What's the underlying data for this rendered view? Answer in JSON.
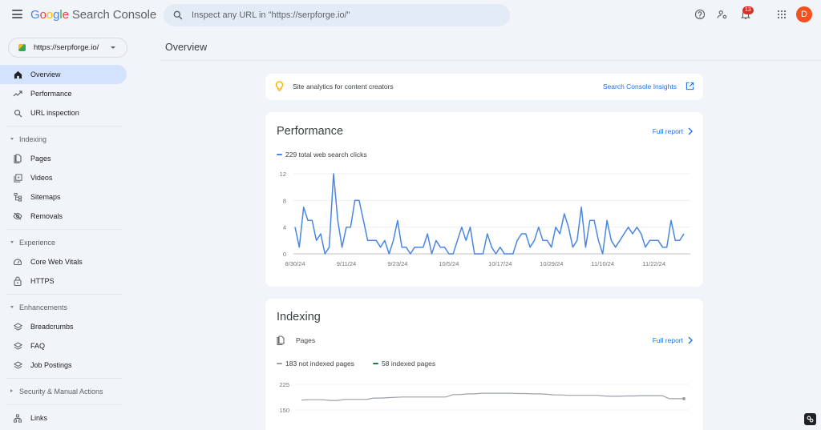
{
  "header": {
    "logo_letters": [
      "G",
      "o",
      "o",
      "g",
      "l",
      "e"
    ],
    "product": "Search Console",
    "search_placeholder": "Inspect any URL in \"https://serpforge.io/\"",
    "notification_count": "13",
    "avatar_initial": "D",
    "avatar_color": "#f4511e"
  },
  "sidebar": {
    "property": "https://serpforge.io/",
    "items": [
      {
        "type": "item",
        "label": "Overview",
        "icon": "home-icon",
        "active": true
      },
      {
        "type": "item",
        "label": "Performance",
        "icon": "trending-icon"
      },
      {
        "type": "item",
        "label": "URL inspection",
        "icon": "search-icon"
      },
      {
        "type": "divider"
      },
      {
        "type": "section",
        "label": "Indexing",
        "expanded": true
      },
      {
        "type": "item",
        "label": "Pages",
        "icon": "pages-icon"
      },
      {
        "type": "item",
        "label": "Videos",
        "icon": "video-icon"
      },
      {
        "type": "item",
        "label": "Sitemaps",
        "icon": "sitemap-icon"
      },
      {
        "type": "item",
        "label": "Removals",
        "icon": "eye-off-icon"
      },
      {
        "type": "divider"
      },
      {
        "type": "section",
        "label": "Experience",
        "expanded": true
      },
      {
        "type": "item",
        "label": "Core Web Vitals",
        "icon": "gauge-icon"
      },
      {
        "type": "item",
        "label": "HTTPS",
        "icon": "lock-icon"
      },
      {
        "type": "divider"
      },
      {
        "type": "section",
        "label": "Enhancements",
        "expanded": true
      },
      {
        "type": "item",
        "label": "Breadcrumbs",
        "icon": "layers-icon"
      },
      {
        "type": "item",
        "label": "FAQ",
        "icon": "layers-icon"
      },
      {
        "type": "item",
        "label": "Job Postings",
        "icon": "layers-icon"
      },
      {
        "type": "divider"
      },
      {
        "type": "section",
        "label": "Security & Manual Actions",
        "expanded": false
      },
      {
        "type": "divider"
      },
      {
        "type": "item",
        "label": "Links",
        "icon": "links-icon"
      }
    ]
  },
  "main": {
    "page_title": "Overview",
    "insights": {
      "text": "Site analytics for content creators",
      "link": "Search Console Insights"
    },
    "performance": {
      "title": "Performance",
      "full_report": "Full report",
      "legend": "229 total web search clicks",
      "accent": "#4a86e0"
    },
    "indexing": {
      "title": "Indexing",
      "subtitle": "Pages",
      "full_report": "Full report",
      "legend_not_indexed": "183 not indexed pages",
      "legend_indexed": "58 indexed pages",
      "not_indexed_color": "#9aa0a6",
      "indexed_color": "#188038"
    }
  },
  "chart_data": [
    {
      "type": "line",
      "title": "Performance",
      "legend": [
        "229 total web search clicks"
      ],
      "ylim": [
        0,
        12
      ],
      "yticks": [
        0,
        4,
        8,
        12
      ],
      "xticks": [
        "8/30/24",
        "9/11/24",
        "9/23/24",
        "10/5/24",
        "10/17/24",
        "10/29/24",
        "11/10/24",
        "11/22/24"
      ],
      "x_start": "8/30/24",
      "grid": true,
      "series": [
        {
          "name": "Clicks",
          "color": "#4a86e0",
          "values": [
            4,
            1,
            7,
            5,
            5,
            2,
            3,
            0,
            1,
            12,
            5,
            1,
            4,
            4,
            8,
            8,
            5,
            2,
            2,
            2,
            1,
            2,
            0,
            2,
            5,
            1,
            1,
            0,
            1,
            1,
            1,
            3,
            0,
            2,
            1,
            1,
            0,
            0,
            2,
            4,
            2,
            4,
            0,
            0,
            0,
            3,
            1,
            0,
            1,
            0,
            0,
            0,
            2,
            3,
            3,
            1,
            2,
            4,
            2,
            2,
            1,
            4,
            3,
            6,
            4,
            1,
            2,
            7,
            1,
            5,
            5,
            2,
            0,
            5,
            2,
            1,
            2,
            3,
            4,
            3,
            4,
            3,
            1,
            2,
            2,
            2,
            1,
            1,
            5,
            2,
            2,
            3
          ]
        }
      ]
    },
    {
      "type": "line",
      "title": "Indexing - Pages",
      "legend": [
        "183 not indexed pages",
        "58 indexed pages"
      ],
      "ylim": [
        150,
        225
      ],
      "yticks": [
        150,
        225
      ],
      "grid": true,
      "series": [
        {
          "name": "Not indexed",
          "color": "#9aa0a6",
          "values": [
            179,
            180,
            180,
            180,
            178,
            178,
            181,
            181,
            181,
            181,
            185,
            185,
            186,
            187,
            188,
            188,
            188,
            188,
            188,
            188,
            188,
            195,
            195,
            197,
            197,
            199,
            199,
            199,
            199,
            199,
            198,
            198,
            197,
            197,
            196,
            194,
            194,
            193,
            193,
            193,
            193,
            193,
            191,
            190,
            190,
            191,
            191,
            192,
            192,
            192,
            192,
            183,
            183,
            183
          ]
        }
      ]
    }
  ]
}
